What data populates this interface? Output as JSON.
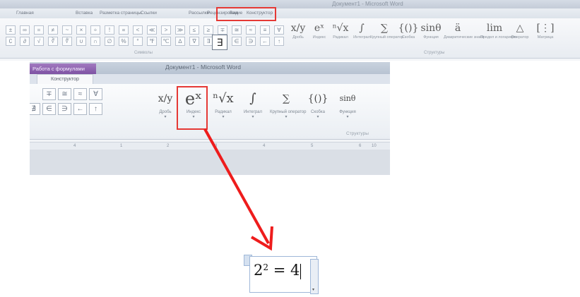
{
  "top_ribbon": {
    "title": "Документ1 - Microsoft Word",
    "tabs": [
      "Главная",
      "Вставка",
      "Разметка страницы",
      "Ссылки",
      "Рассылки",
      "Рецензирование",
      "Вид",
      "Конструктор"
    ],
    "active_tab": "Конструктор",
    "symbols": [
      "±",
      "∞",
      "=",
      "≠",
      "~",
      "×",
      "÷",
      "!",
      "∝",
      "<",
      "≪",
      ">",
      "≫",
      "≤",
      "≥",
      "∓",
      "≅",
      "≈",
      "≡",
      "∀",
      "∁",
      "∂",
      "√",
      "∛",
      "∜",
      "∪",
      "∩",
      "∅",
      "%",
      "°",
      "℉",
      "℃",
      "∆",
      "∇",
      "∃",
      "∄",
      "∈",
      "∋",
      "←",
      "↑"
    ],
    "selected_symbol": "∃",
    "group_symbols": "Символы",
    "group_structures": "Структуры",
    "structures": [
      {
        "glyph": "x/y",
        "label": "Дробь"
      },
      {
        "glyph": "eˣ",
        "label": "Индекс"
      },
      {
        "glyph": "ⁿ√x",
        "label": "Радикал"
      },
      {
        "glyph": "∫",
        "label": "Интеграл"
      },
      {
        "glyph": "∑",
        "label": "Крупный оператор"
      },
      {
        "glyph": "{()}",
        "label": "Скобка"
      },
      {
        "glyph": "sinθ",
        "label": "Функция"
      },
      {
        "glyph": "ä",
        "label": "Диакритические знаки"
      },
      {
        "glyph": "lim",
        "label": "Предел и логарифм"
      },
      {
        "glyph": "△",
        "label": "Оператор"
      },
      {
        "glyph": "[⋮]",
        "label": "Матрица"
      }
    ]
  },
  "word_window": {
    "context_tab": "Работа с формулами",
    "title": "Документ1 - Microsoft Word",
    "active_tab": "Конструктор",
    "symbols_row1": [
      "∓",
      "≅",
      "≈",
      "∀"
    ],
    "symbols_row2": [
      "∄",
      "∈",
      "∋",
      "←",
      "↑"
    ],
    "structures": [
      {
        "glyph": "x/y",
        "label": "Дробь"
      },
      {
        "glyph": "eˣ",
        "label": "Индекс"
      },
      {
        "glyph": "ⁿ√x",
        "label": "Радикал"
      },
      {
        "glyph": "∫",
        "label": "Интеграл"
      },
      {
        "glyph": "∑",
        "label": "Крупный оператор"
      },
      {
        "glyph": "{()}",
        "label": "Скобка"
      },
      {
        "glyph": "sinθ",
        "label": "Функция"
      }
    ],
    "group_structures": "Структуры",
    "ruler_numbers": [
      "4",
      "1",
      "2",
      "3",
      "4",
      "5",
      "6",
      "10"
    ]
  },
  "result": {
    "base": "2",
    "exponent": "2",
    "rest": " = 4"
  },
  "colors": {
    "highlight": "#e53935",
    "context_tab": "#8e5fb3"
  }
}
